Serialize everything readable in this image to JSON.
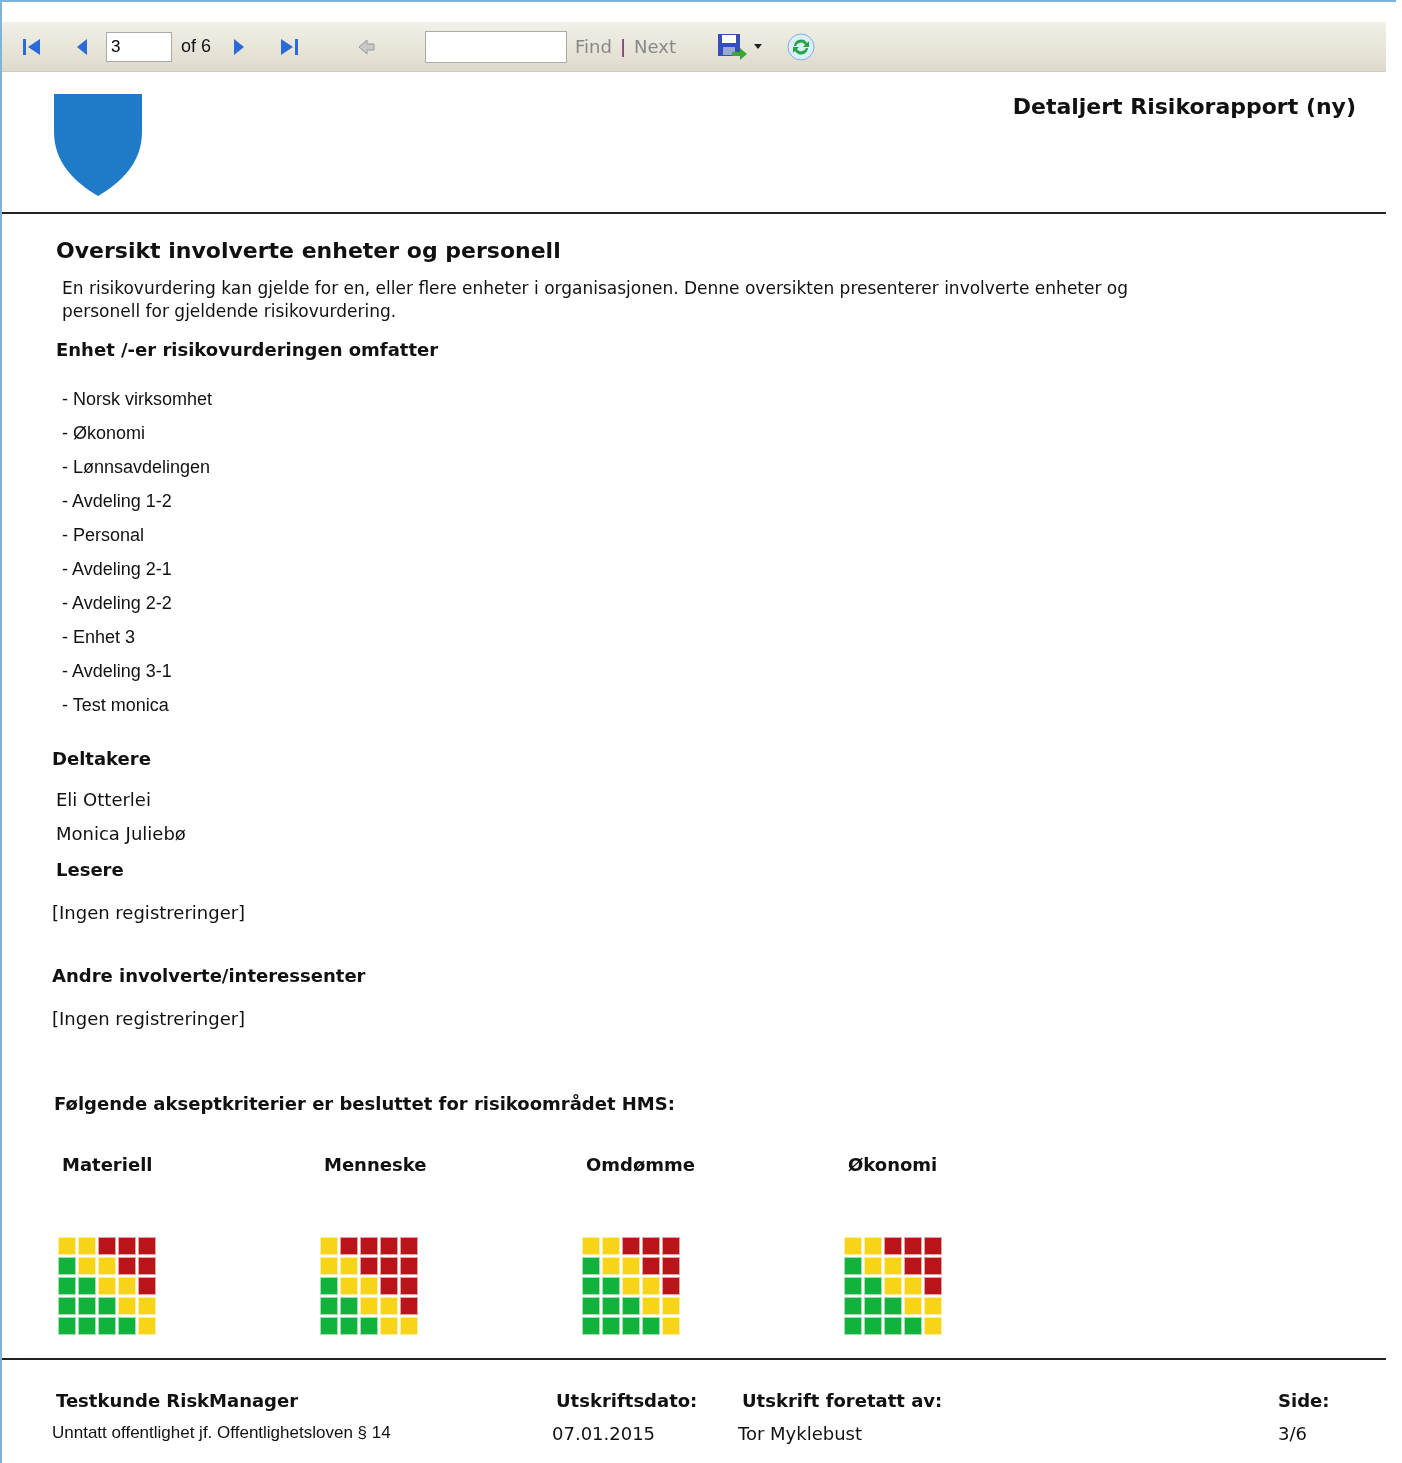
{
  "toolbar": {
    "page": "3",
    "of": "of 6",
    "find": "Find",
    "separator": "|",
    "next": "Next"
  },
  "report": {
    "title": "Detaljert Risikorapport (ny)"
  },
  "section": {
    "heading": "Oversikt involverte enheter og personell",
    "intro": "En risikovurdering kan gjelde for en, eller flere enheter i organisasjonen. Denne oversikten presenterer involverte enheter og personell for gjeldende risikovurdering."
  },
  "units": {
    "heading": "Enhet /-er risikovurderingen omfatter",
    "items": [
      "- Norsk virksomhet",
      "- Økonomi",
      "- Lønnsavdelingen",
      "- Avdeling 1-2",
      "- Personal",
      "- Avdeling 2-1",
      "- Avdeling 2-2",
      "- Enhet 3",
      "- Avdeling 3-1",
      "- Test monica"
    ]
  },
  "participants": {
    "heading": "Deltakere",
    "items": [
      "Eli Otterlei",
      "Monica Juliebø"
    ]
  },
  "readers": {
    "heading": "Lesere",
    "empty": "[Ingen registreringer]"
  },
  "others": {
    "heading": "Andre involverte/interessenter",
    "empty": "[Ingen registreringer]"
  },
  "criteria": {
    "heading": "Følgende akseptkriterier er besluttet for risikoområdet HMS:",
    "matrices": [
      {
        "name": "Materiell",
        "rows": [
          [
            {
              "color": "#f7d417"
            },
            {
              "color": "#f7d417"
            },
            {
              "color": "#b8141a"
            },
            {
              "color": "#b8141a"
            },
            {
              "color": "#b8141a"
            }
          ],
          [
            {
              "color": "#12b33c"
            },
            {
              "color": "#f7d417"
            },
            {
              "color": "#f7d417"
            },
            {
              "color": "#b8141a"
            },
            {
              "color": "#b8141a"
            }
          ],
          [
            {
              "color": "#12b33c"
            },
            {
              "color": "#12b33c"
            },
            {
              "color": "#f7d417"
            },
            {
              "color": "#f7d417"
            },
            {
              "color": "#b8141a"
            }
          ],
          [
            {
              "color": "#12b33c"
            },
            {
              "color": "#12b33c"
            },
            {
              "color": "#12b33c"
            },
            {
              "color": "#f7d417"
            },
            {
              "color": "#f7d417"
            }
          ],
          [
            {
              "color": "#12b33c"
            },
            {
              "color": "#12b33c"
            },
            {
              "color": "#12b33c"
            },
            {
              "color": "#12b33c"
            },
            {
              "color": "#f7d417"
            }
          ]
        ]
      },
      {
        "name": "Menneske",
        "rows": [
          [
            {
              "color": "#f7d417"
            },
            {
              "color": "#b8141a"
            },
            {
              "color": "#b8141a"
            },
            {
              "color": "#b8141a"
            },
            {
              "color": "#b8141a"
            }
          ],
          [
            {
              "color": "#f7d417"
            },
            {
              "color": "#f7d417"
            },
            {
              "color": "#b8141a"
            },
            {
              "color": "#b8141a"
            },
            {
              "color": "#b8141a"
            }
          ],
          [
            {
              "color": "#12b33c"
            },
            {
              "color": "#f7d417"
            },
            {
              "color": "#f7d417"
            },
            {
              "color": "#b8141a"
            },
            {
              "color": "#b8141a"
            }
          ],
          [
            {
              "color": "#12b33c"
            },
            {
              "color": "#12b33c"
            },
            {
              "color": "#f7d417"
            },
            {
              "color": "#f7d417"
            },
            {
              "color": "#b8141a"
            }
          ],
          [
            {
              "color": "#12b33c"
            },
            {
              "color": "#12b33c"
            },
            {
              "color": "#12b33c"
            },
            {
              "color": "#f7d417"
            },
            {
              "color": "#f7d417"
            }
          ]
        ]
      },
      {
        "name": "Omdømme",
        "rows": [
          [
            {
              "color": "#f7d417"
            },
            {
              "color": "#f7d417"
            },
            {
              "color": "#b8141a"
            },
            {
              "color": "#b8141a"
            },
            {
              "color": "#b8141a"
            }
          ],
          [
            {
              "color": "#12b33c"
            },
            {
              "color": "#f7d417"
            },
            {
              "color": "#f7d417"
            },
            {
              "color": "#b8141a"
            },
            {
              "color": "#b8141a"
            }
          ],
          [
            {
              "color": "#12b33c"
            },
            {
              "color": "#12b33c"
            },
            {
              "color": "#f7d417"
            },
            {
              "color": "#f7d417"
            },
            {
              "color": "#b8141a"
            }
          ],
          [
            {
              "color": "#12b33c"
            },
            {
              "color": "#12b33c"
            },
            {
              "color": "#12b33c"
            },
            {
              "color": "#f7d417"
            },
            {
              "color": "#f7d417"
            }
          ],
          [
            {
              "color": "#12b33c"
            },
            {
              "color": "#12b33c"
            },
            {
              "color": "#12b33c"
            },
            {
              "color": "#12b33c"
            },
            {
              "color": "#f7d417"
            }
          ]
        ]
      },
      {
        "name": "Økonomi",
        "rows": [
          [
            {
              "color": "#f7d417"
            },
            {
              "color": "#f7d417"
            },
            {
              "color": "#b8141a"
            },
            {
              "color": "#b8141a"
            },
            {
              "color": "#b8141a"
            }
          ],
          [
            {
              "color": "#12b33c"
            },
            {
              "color": "#f7d417"
            },
            {
              "color": "#f7d417"
            },
            {
              "color": "#b8141a"
            },
            {
              "color": "#b8141a"
            }
          ],
          [
            {
              "color": "#12b33c"
            },
            {
              "color": "#12b33c"
            },
            {
              "color": "#f7d417"
            },
            {
              "color": "#f7d417"
            },
            {
              "color": "#b8141a"
            }
          ],
          [
            {
              "color": "#12b33c"
            },
            {
              "color": "#12b33c"
            },
            {
              "color": "#12b33c"
            },
            {
              "color": "#f7d417"
            },
            {
              "color": "#f7d417"
            }
          ],
          [
            {
              "color": "#12b33c"
            },
            {
              "color": "#12b33c"
            },
            {
              "color": "#12b33c"
            },
            {
              "color": "#12b33c"
            },
            {
              "color": "#f7d417"
            }
          ]
        ]
      }
    ]
  },
  "footer": {
    "company": "Testkunde RiskManager",
    "note": "Unntatt offentlighet jf. Offentlighetsloven § 14",
    "date_label": "Utskriftsdato:",
    "date": "07.01.2015",
    "by_label": "Utskrift foretatt av:",
    "by": "Tor Myklebust",
    "page_label": "Side:",
    "page": "3/6"
  }
}
